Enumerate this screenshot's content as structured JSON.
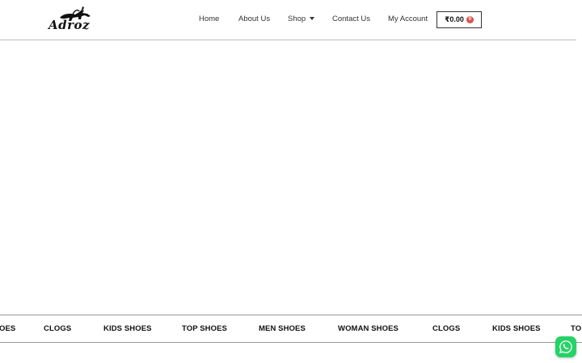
{
  "brand": {
    "logo_text": "Adroz"
  },
  "nav": {
    "home": "Home",
    "about": "About Us",
    "shop": "Shop",
    "contact": "Contact Us",
    "account": "My Account"
  },
  "cart": {
    "amount": "₹0.00",
    "count": "0"
  },
  "marquee": {
    "items": [
      "OES",
      "CLOGS",
      "KIDS SHOES",
      "TOP SHOES",
      "MEN SHOES",
      "WOMAN SHOES",
      "CLOGS",
      "KIDS SHOES",
      "TO"
    ]
  },
  "icons": {
    "logo": "horse-rider-logo-icon",
    "shop_dropdown": "caret-down-icon",
    "whatsapp": "whatsapp-icon"
  },
  "colors": {
    "badge": "#d9534f",
    "whatsapp": "#25d366",
    "border": "#bdbdbd"
  }
}
